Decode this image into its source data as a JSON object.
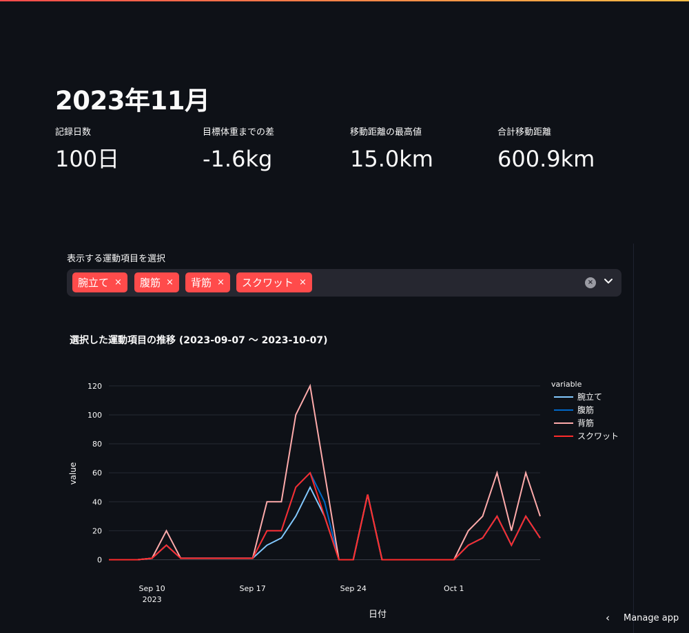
{
  "page": {
    "title": "2023年11月"
  },
  "metrics": [
    {
      "label": "記録日数",
      "value": "100日"
    },
    {
      "label": "目標体重までの差",
      "value": "-1.6kg"
    },
    {
      "label": "移動距離の最高値",
      "value": "15.0km"
    },
    {
      "label": "合計移動距離",
      "value": "600.9km"
    }
  ],
  "selector": {
    "label": "表示する運動項目を選択",
    "chips": [
      "腕立て",
      "腹筋",
      "背筋",
      "スクワット"
    ],
    "chip_remove": "×",
    "clear": "×"
  },
  "chart_title": "選択した運動項目の推移 (2023-09-07 〜 2023-10-07)",
  "manage_app": {
    "label": "Manage app",
    "icon": "chevron-left-icon"
  },
  "chart_data": {
    "type": "line",
    "title": "選択した運動項目の推移 (2023-09-07 〜 2023-10-07)",
    "xlabel": "日付",
    "ylabel": "value",
    "legend_title": "variable",
    "legend_position": "right",
    "x": [
      "2023-09-07",
      "2023-09-08",
      "2023-09-09",
      "2023-09-10",
      "2023-09-11",
      "2023-09-12",
      "2023-09-13",
      "2023-09-14",
      "2023-09-15",
      "2023-09-16",
      "2023-09-17",
      "2023-09-18",
      "2023-09-19",
      "2023-09-20",
      "2023-09-21",
      "2023-09-22",
      "2023-09-23",
      "2023-09-24",
      "2023-09-25",
      "2023-09-26",
      "2023-09-27",
      "2023-09-28",
      "2023-09-29",
      "2023-09-30",
      "2023-10-01",
      "2023-10-02",
      "2023-10-03",
      "2023-10-04",
      "2023-10-05",
      "2023-10-06",
      "2023-10-07"
    ],
    "xticks": [
      {
        "date": "2023-09-10",
        "label": "Sep 10",
        "sublabel": "2023"
      },
      {
        "date": "2023-09-17",
        "label": "Sep 17",
        "sublabel": ""
      },
      {
        "date": "2023-09-24",
        "label": "Sep 24",
        "sublabel": ""
      },
      {
        "date": "2023-10-01",
        "label": "Oct 1",
        "sublabel": ""
      }
    ],
    "yticks": [
      0,
      20,
      40,
      60,
      80,
      100,
      120
    ],
    "ylim": [
      -5,
      128
    ],
    "grid": true,
    "series": [
      {
        "name": "腕立て",
        "color": "#83c9ff",
        "values": [
          0,
          0,
          0,
          1,
          10,
          1,
          1,
          1,
          1,
          1,
          1,
          10,
          15,
          30,
          50,
          30,
          0,
          0,
          45,
          0,
          0,
          0,
          0,
          0,
          0,
          10,
          15,
          30,
          10,
          30,
          15
        ]
      },
      {
        "name": "腹筋",
        "color": "#0068c9",
        "values": [
          0,
          0,
          0,
          1,
          10,
          1,
          1,
          1,
          1,
          1,
          1,
          20,
          20,
          50,
          60,
          40,
          0,
          0,
          45,
          0,
          0,
          0,
          0,
          0,
          0,
          10,
          15,
          30,
          10,
          30,
          15
        ]
      },
      {
        "name": "背筋",
        "color": "#ffabab",
        "values": [
          0,
          0,
          0,
          1,
          20,
          1,
          1,
          1,
          1,
          1,
          1,
          40,
          40,
          100,
          120,
          60,
          0,
          0,
          45,
          0,
          0,
          0,
          0,
          0,
          0,
          20,
          30,
          60,
          20,
          60,
          30
        ]
      },
      {
        "name": "スクワット",
        "color": "#ff2b2b",
        "values": [
          0,
          0,
          0,
          1,
          10,
          1,
          1,
          1,
          1,
          1,
          1,
          20,
          20,
          50,
          60,
          30,
          0,
          0,
          45,
          0,
          0,
          0,
          0,
          0,
          0,
          10,
          15,
          30,
          10,
          30,
          15
        ]
      }
    ]
  }
}
